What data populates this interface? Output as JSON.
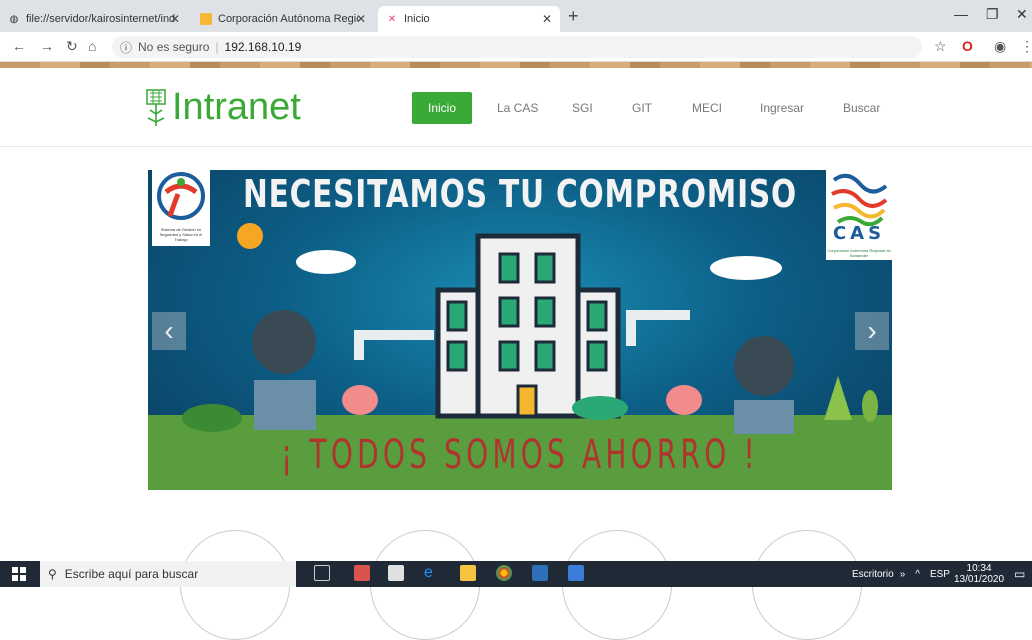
{
  "browser": {
    "tabs": [
      {
        "title": "file://servidor/kairosinternet/inde"
      },
      {
        "title": "Corporación Autónoma Regional"
      },
      {
        "title": "Inicio"
      }
    ],
    "security_label": "No es seguro",
    "url": "192.168.10.19"
  },
  "site": {
    "logo_text": "Intranet",
    "nav": [
      "Inicio",
      "La CAS",
      "SGI",
      "GIT",
      "MECI",
      "Ingresar",
      "Buscar"
    ]
  },
  "banner": {
    "title": "NECESITAMOS TU COMPROMISO",
    "subtitle": "¡ TODOS SOMOS AHORRO !",
    "cas_logo_text": "CAS",
    "cas_tagline": "Corporación Autónoma Regional de Santander",
    "sgsst_text": "Sistema de Gestión en Seguridad y Salud en el Trabajo"
  },
  "taskbar": {
    "search_placeholder": "Escribe aquí para buscar",
    "desktop_label": "Escritorio",
    "language": "ESP",
    "time": "10:34",
    "date": "13/01/2020"
  },
  "colors": {
    "brand_green": "#3aa935",
    "banner_blue": "#0d5f87",
    "subtitle_red": "#b0342d"
  }
}
